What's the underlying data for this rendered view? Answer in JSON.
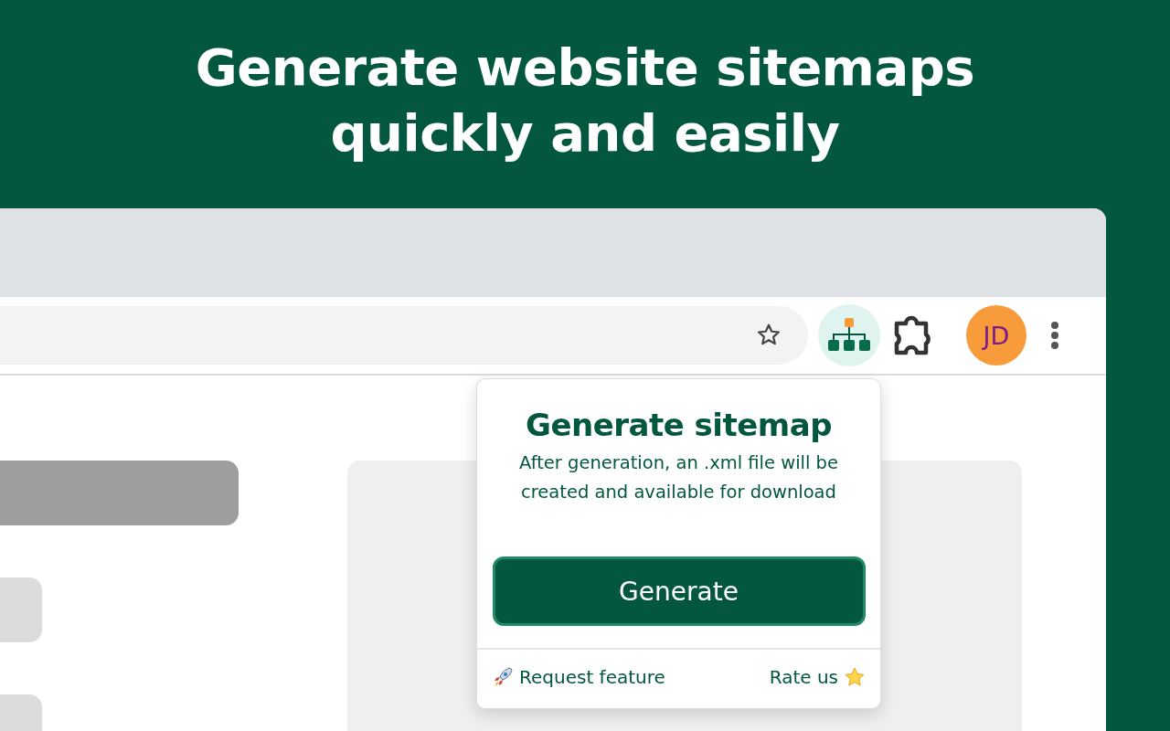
{
  "headline": [
    "Generate website sitemaps",
    "quickly and easily"
  ],
  "toolbar": {
    "avatar_initials": "JD"
  },
  "popup": {
    "title": "Generate sitemap",
    "description": "After generation, an .xml file will be created and available for download",
    "button": "Generate",
    "links": [
      {
        "label": "Request feature",
        "kind": "request"
      },
      {
        "label": "Rate us",
        "kind": "rate"
      }
    ]
  }
}
